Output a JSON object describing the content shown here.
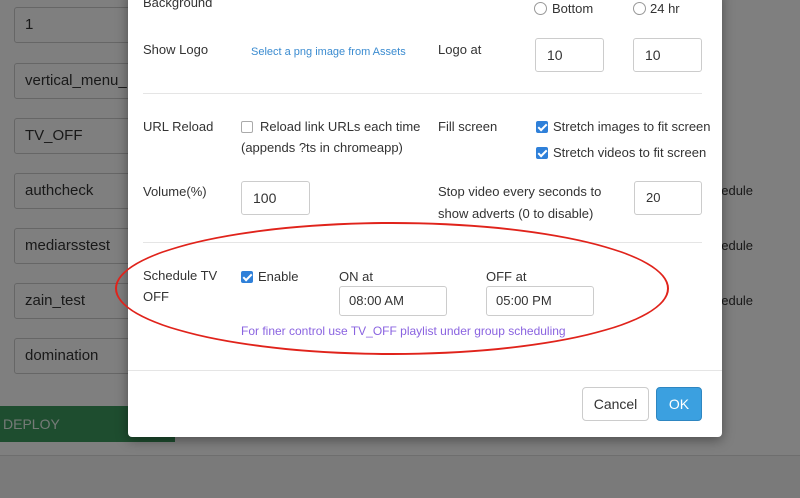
{
  "background": {
    "rows": [
      {
        "value": "1"
      },
      {
        "value": "vertical_menu_HD"
      },
      {
        "value": "TV_OFF"
      },
      {
        "value": "authcheck"
      },
      {
        "value": "mediarsstest"
      },
      {
        "value": "zain_test"
      },
      {
        "value": "domination"
      }
    ],
    "right_labels": [
      "hedule",
      "hedule",
      "hedule"
    ],
    "deploy_label": "DEPLOY"
  },
  "modal": {
    "background_label": "Background",
    "position_bottom": "Bottom",
    "clock_24hr": "24 hr",
    "show_logo_label": "Show Logo",
    "logo_link": "Select a png image from Assets",
    "logo_at_label": "Logo at",
    "logo_x": "10",
    "logo_y": "10",
    "url_reload_label": "URL Reload",
    "url_reload_option": "Reload link URLs each time",
    "url_reload_note": "(appends ?ts in chromeapp)",
    "fill_screen_label": "Fill screen",
    "stretch_images": "Stretch images to fit screen",
    "stretch_videos": "Stretch videos to fit screen",
    "volume_label": "Volume(%)",
    "volume_value": "100",
    "stop_video_label_line1": "Stop video every seconds to",
    "stop_video_label_line2": "show adverts (0 to disable)",
    "stop_video_value": "20",
    "schedule_label_line1": "Schedule TV",
    "schedule_label_line2": "OFF",
    "enable_label": "Enable",
    "on_at_label": "ON at",
    "on_at_value": "08:00 AM",
    "off_at_label": "OFF at",
    "off_at_value": "05:00 PM",
    "finer_control_note": "For finer control use TV_OFF playlist under group scheduling",
    "cancel_label": "Cancel",
    "ok_label": "OK"
  },
  "colors": {
    "accent": "#3ba0e0",
    "checkbox": "#2f80d9",
    "link": "#3a8bd0",
    "note": "#8a63e0",
    "annotation": "#e0231b",
    "deploy": "#3c9a5f"
  }
}
